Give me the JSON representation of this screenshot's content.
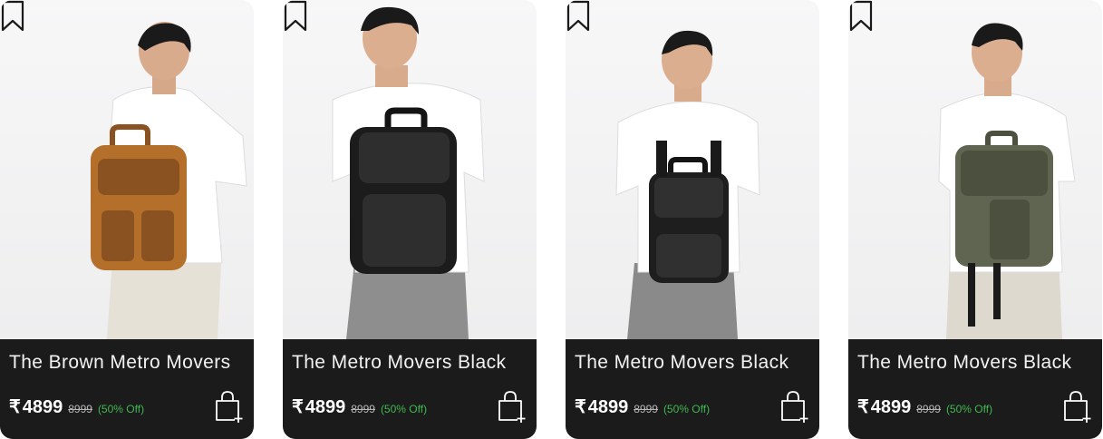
{
  "products": [
    {
      "title": "The Brown Metro Movers",
      "currency": "₹",
      "price": "4899",
      "mrp": "8999",
      "discount": "(50% Off)",
      "bag_color": "#b4702b",
      "bag_accent": "#8a5220"
    },
    {
      "title": "The Metro Movers Black",
      "currency": "₹",
      "price": "4899",
      "mrp": "8999",
      "discount": "(50% Off)",
      "bag_color": "#1c1c1c",
      "bag_accent": "#2e2e2e"
    },
    {
      "title": "The Metro Movers Black",
      "currency": "₹",
      "price": "4899",
      "mrp": "8999",
      "discount": "(50% Off)",
      "bag_color": "#1e1e1e",
      "bag_accent": "#303030"
    },
    {
      "title": "The Metro Movers Black",
      "currency": "₹",
      "price": "4899",
      "mrp": "8999",
      "discount": "(50% Off)",
      "bag_color": "#5f6551",
      "bag_accent": "#4c513f"
    }
  ],
  "icons": {
    "bookmark": "bookmark-icon",
    "cart": "add-to-cart-icon"
  },
  "colors": {
    "info_panel": "#1b1b1b",
    "discount": "#3fb950"
  }
}
